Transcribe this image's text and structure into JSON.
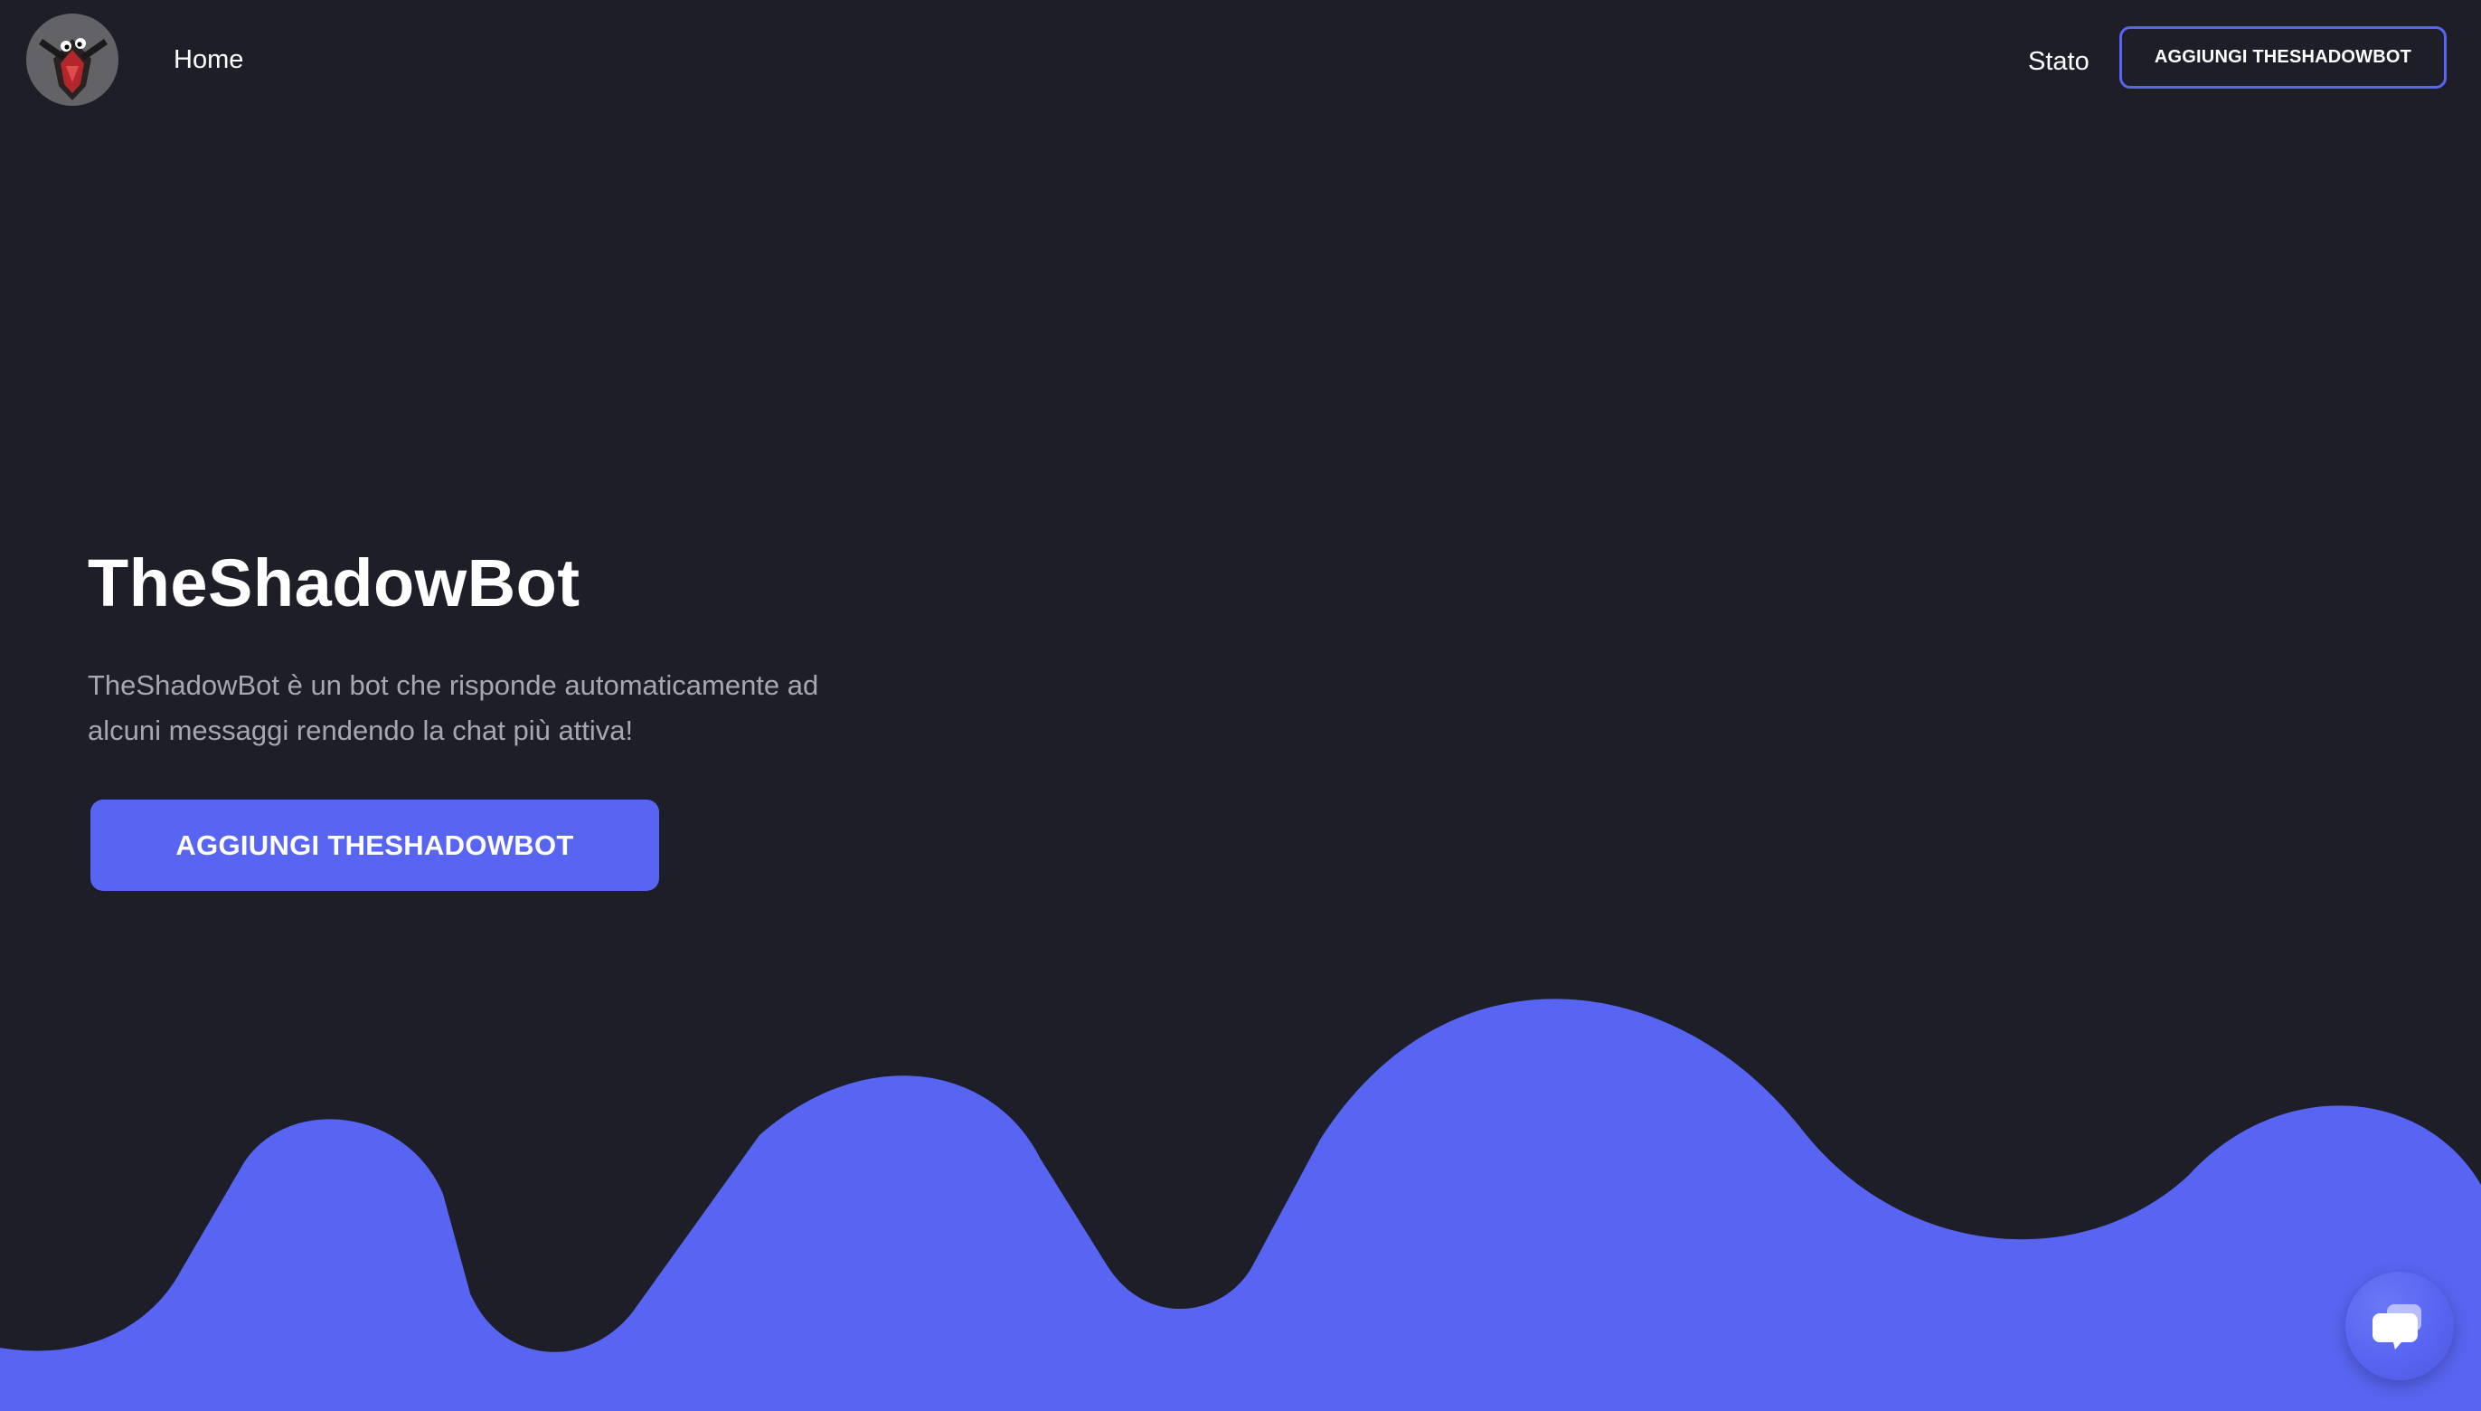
{
  "navbar": {
    "logo_alt": "TheShadowBot logo",
    "home_label": "Home",
    "status_label": "Stato",
    "cta_label": "AGGIUNGI THESHADOWBOT"
  },
  "hero": {
    "title": "TheShadowBot",
    "description": "TheShadowBot è un bot che risponde automaticamente ad alcuni messaggi rendendo la chat più attiva!",
    "cta_label": "AGGIUNGI THESHADOWBOT"
  },
  "theme": {
    "background": "#1e1e29",
    "accent": "#5865f2",
    "text_primary": "#ffffff",
    "text_muted": "#a7a7b0"
  },
  "icons": {
    "logo": "bot-avatar-icon",
    "chat": "chat-bubbles-icon"
  }
}
